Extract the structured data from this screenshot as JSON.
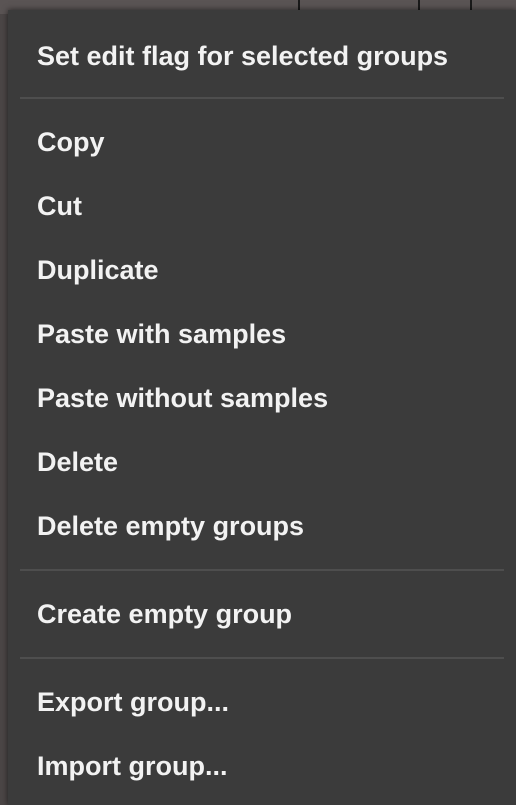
{
  "context_menu": {
    "items": [
      {
        "label": "Set edit flag for selected groups"
      },
      {
        "label": "Copy"
      },
      {
        "label": "Cut"
      },
      {
        "label": "Duplicate"
      },
      {
        "label": "Paste with samples"
      },
      {
        "label": "Paste without samples"
      },
      {
        "label": "Delete"
      },
      {
        "label": "Delete empty groups"
      },
      {
        "label": "Create empty group"
      },
      {
        "label": "Export group..."
      },
      {
        "label": "Import group..."
      }
    ]
  },
  "colors": {
    "menu_background": "#3b3b3b",
    "menu_text": "#f2f2f2",
    "separator": "#4e4e4e"
  }
}
